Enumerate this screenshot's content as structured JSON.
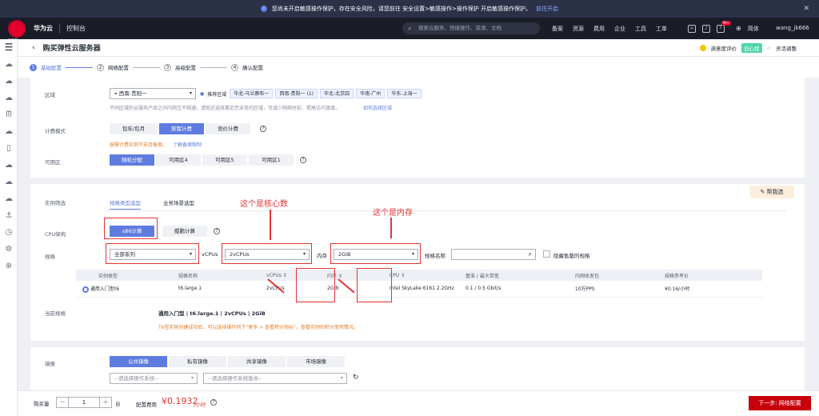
{
  "notice": {
    "text": "您尚未开启敏感操作保护，存在安全风险，请您前往 安全设置>敏感操作>操作保护 开启敏感操作保护。",
    "link": "前往开启",
    "close": "✕"
  },
  "topbar": {
    "logo": "HUAWEI",
    "brand": "华为云",
    "console": "控制台",
    "search_placeholder": "搜索云服务、快捷操作、资源、文档",
    "nav": [
      "备案",
      "资源",
      "费用",
      "企业",
      "工具",
      "工单"
    ],
    "badge": "99+",
    "lang": "简体",
    "user": "wang_jk666"
  },
  "title": {
    "text": "购买弹性云服务器",
    "satisfaction": "满意度评价",
    "beta": "旧心程",
    "flexible": "灵活调整"
  },
  "steps": [
    {
      "n": "1",
      "label": "基础配置"
    },
    {
      "n": "2",
      "label": "网络配置"
    },
    {
      "n": "3",
      "label": "高级配置"
    },
    {
      "n": "4",
      "label": "确认配置"
    }
  ],
  "region": {
    "label": "区域",
    "value": "西南-贵阳一",
    "recommend": "推荐区域",
    "tags": [
      "华北-乌兰察布一",
      "西南-贵阳一 (1)",
      "华北-北京四",
      "华南-广州",
      "华东-上海一"
    ],
    "hint": "不同区域的云服务产品之间内网互不相通；请就近选择靠近您业务的区域，可减少网络时延、提高访问速度。",
    "hint_link": "如何选择区域"
  },
  "billing": {
    "label": "计费模式",
    "options": [
      "包年/包月",
      "按需计费",
      "竞价计费"
    ],
    "selected": 1,
    "warn": "按需计费实例不支持备案。",
    "warn_link": "了解备案限制"
  },
  "az": {
    "label": "可用区",
    "options": [
      "随机分配",
      "可用区4",
      "可用区5",
      "可用区1"
    ],
    "selected": 0
  },
  "flavor": {
    "label": "实例筛选",
    "tabs": [
      "规格类型选型",
      "业务场景选型"
    ],
    "help": "帮我选",
    "cpu_label": "CPU架构",
    "cpu_options": [
      "x86计算",
      "鲲鹏计算"
    ],
    "spec_label": "规格",
    "series": "全部系列",
    "vcpu_label": "vCPUs",
    "vcpu": "2vCPUs",
    "mem_label": "内存",
    "mem": "2GiB",
    "name_label": "规格名称",
    "hide_sold": "隐藏售罄的规格"
  },
  "annot": {
    "cores": "这个是核心数",
    "memory": "这个是内存"
  },
  "table": {
    "headers": [
      "实例类型",
      "规格名称",
      "vCPUs ⇕",
      "内存 ⇕",
      "CPU ⇕",
      "基准 / 最大带宽",
      "内网收发包",
      "规格参考价"
    ],
    "row": [
      "通用入门型t6",
      "t6.large.1",
      "2vCPUs",
      "2GiB",
      "Intel SkyLake 6161 2.2GHz",
      "0.1 / 0.5 Gbit/s",
      "10万PPS",
      "¥0.16/小时"
    ]
  },
  "current": {
    "label": "当前规格",
    "value": "通用入门型 | t6.large.1 | 2vCPUs | 2GiB",
    "note": "T6型实例创建成功后，可以选择操作列下\"更多 > 查看积分指标\"，查看实例的积分使用情况。"
  },
  "image": {
    "label": "镜像",
    "tabs": [
      "公共镜像",
      "私有镜像",
      "共享镜像",
      "市场镜像"
    ],
    "os_placeholder": "--请选择操作系统--",
    "ver_placeholder": "--请选择操作系统版本--"
  },
  "bottom": {
    "qty_label": "购买量",
    "qty": "1",
    "unit": "台",
    "price_label": "配置费用",
    "price": "¥0.1932",
    "price_unit": "/小时",
    "next": "下一步: 网络配置"
  }
}
